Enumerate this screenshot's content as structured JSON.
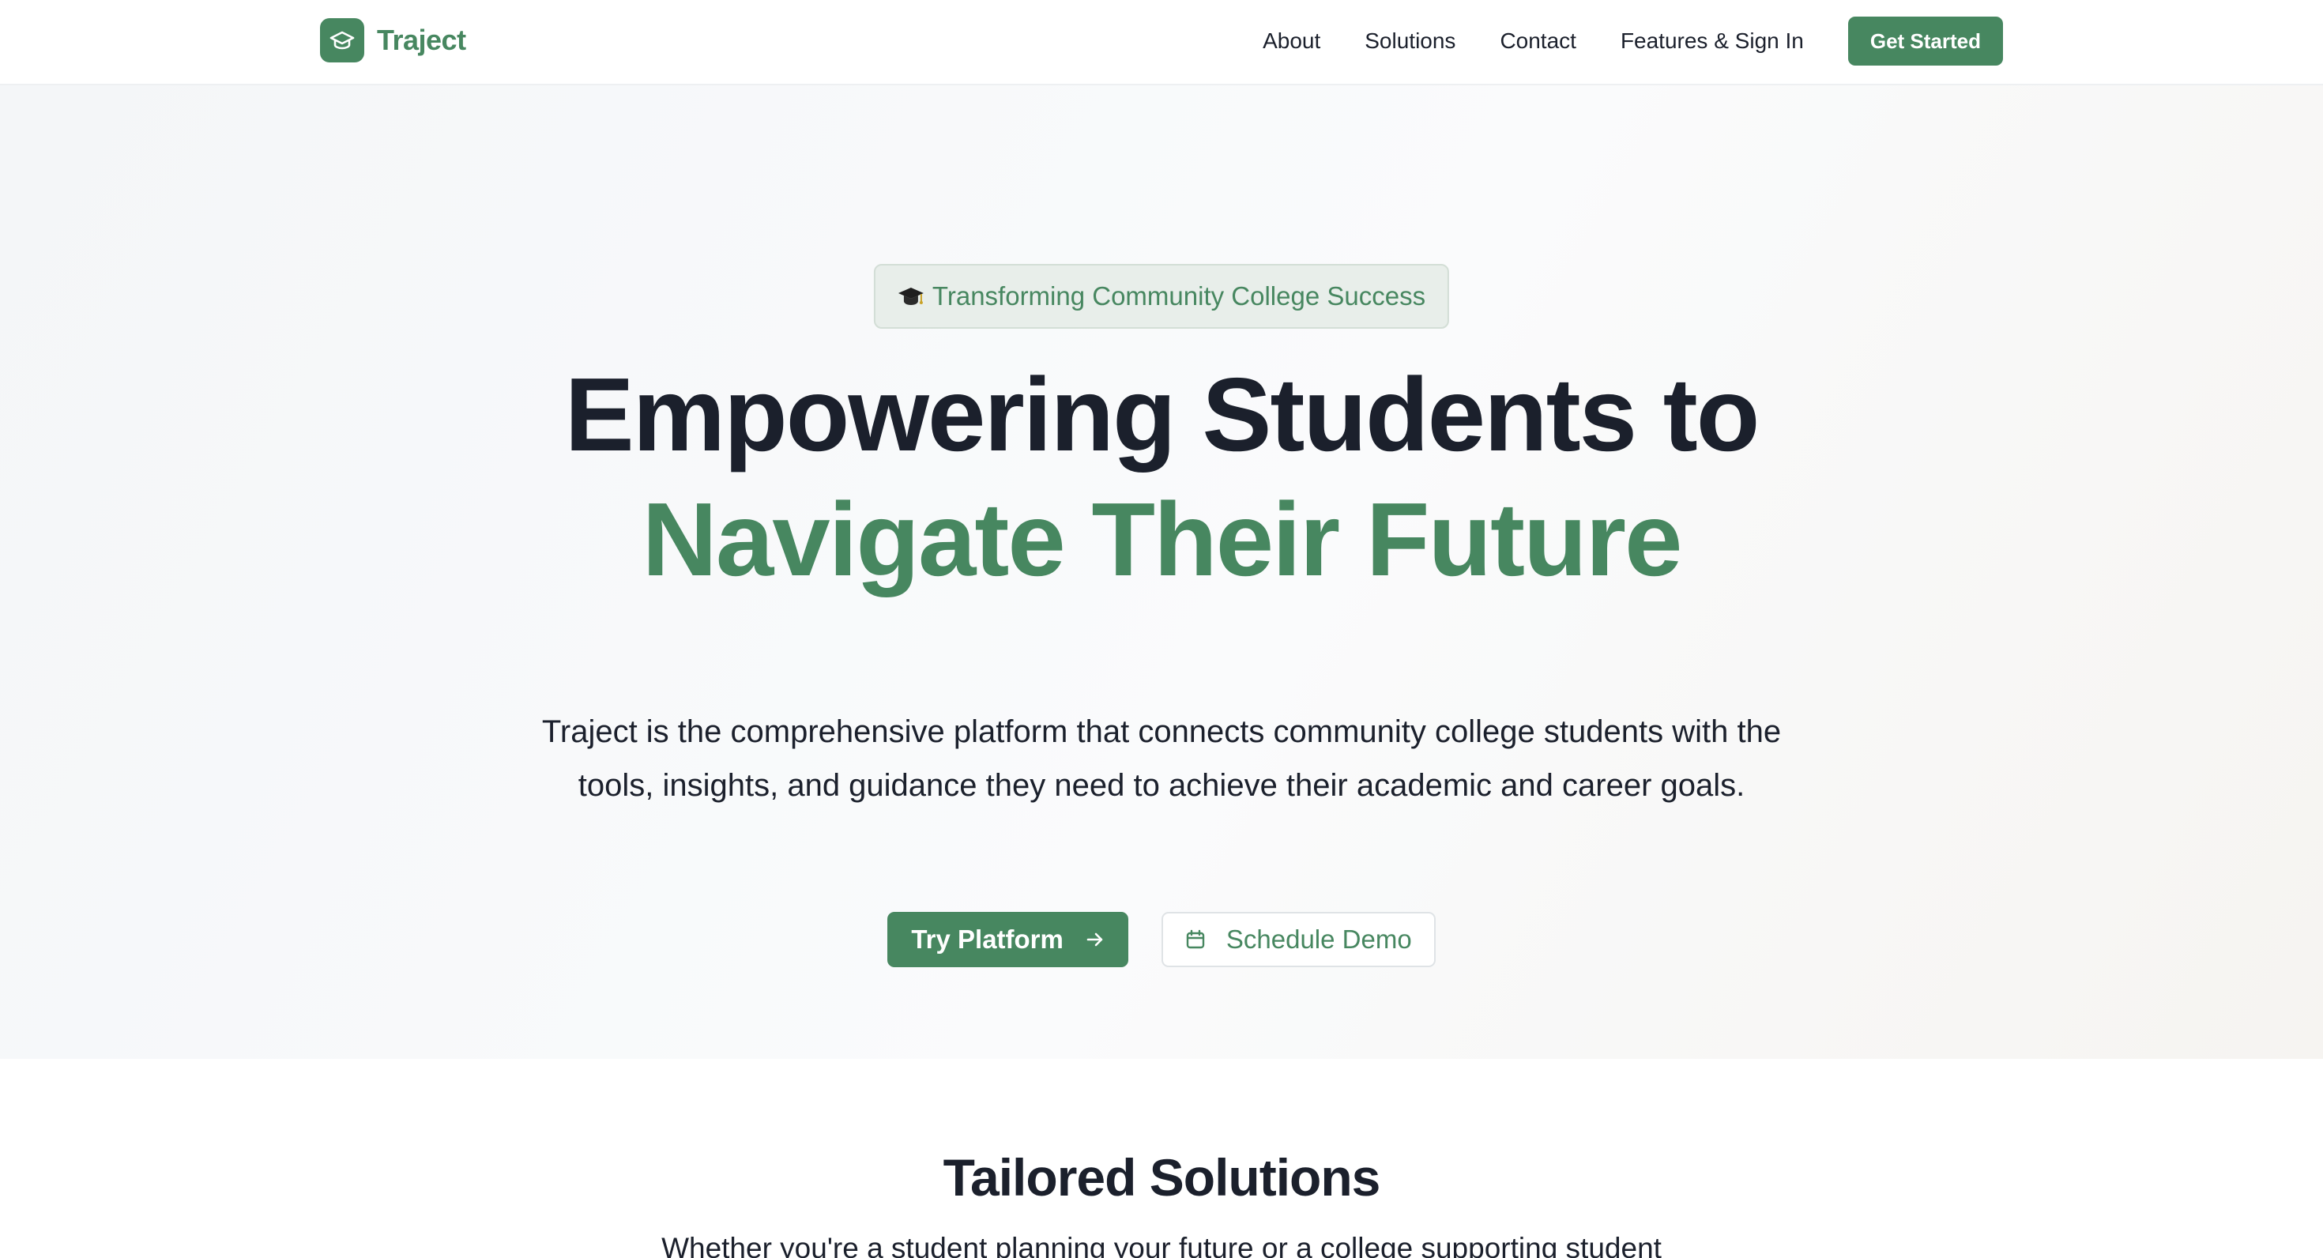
{
  "colors": {
    "brand_green": "#478760",
    "text_dark": "#1b202c",
    "badge_bg": "#e8eeea"
  },
  "nav": {
    "brand_name": "Traject",
    "brand_icon": "graduation-cap-icon",
    "links": [
      "About",
      "Solutions",
      "Contact",
      "Features & Sign In"
    ],
    "cta_label": "Get Started"
  },
  "hero": {
    "badge_icon": "graduation-cap-emoji",
    "badge_text": "Transforming Community College Success",
    "headline_line1": "Empowering Students to",
    "headline_line2": "Navigate Their Future",
    "subtitle": "Traject is the comprehensive platform that connects community college students with the tools, insights, and guidance they need to achieve their academic and career goals.",
    "primary_button": "Try Platform",
    "primary_button_icon": "arrow-right-icon",
    "secondary_button": "Schedule Demo",
    "secondary_button_icon": "calendar-icon"
  },
  "solutions": {
    "title": "Tailored Solutions",
    "subtitle": "Whether you're a student planning your future or a college supporting student"
  }
}
